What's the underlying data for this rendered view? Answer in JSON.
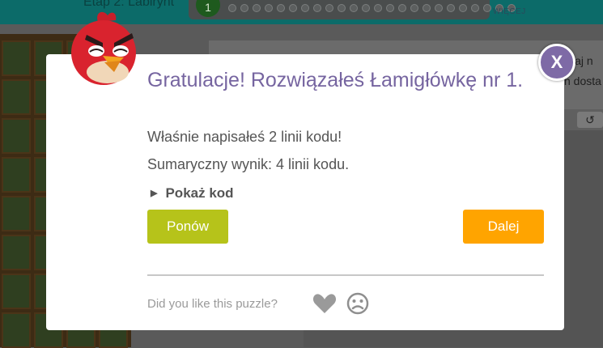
{
  "header": {
    "stage_title": "Etap 2: Labirynt",
    "current_level": "1",
    "more_label": "WIĘCEJ",
    "level_count": 24
  },
  "instructions": {
    "line1": "viaj n",
    "line2": "n dosta"
  },
  "modal": {
    "title": "Gratulacje! Rozwiązałeś Łamigłówkę nr 1.",
    "lines_written": "Właśnie napisałeś 2 linii kodu!",
    "total_score": "Sumaryczny wynik: 4 linii kodu.",
    "show_code": "Pokaż kod",
    "again_button": "Ponów",
    "continue_button": "Dalej",
    "close_button": "X",
    "feedback_question": "Did you like this puzzle?"
  },
  "colors": {
    "title": "#7665a0",
    "again": "#b6c31a",
    "continue": "#ffa400",
    "close": "#7e6aa6",
    "bird": "#d9232e"
  },
  "icons": {
    "bird": "red-bird-avatar-icon",
    "close": "close-icon",
    "expand": "triangle-right-icon",
    "like": "heart-icon",
    "dislike": "sad-face-icon",
    "reset": "reset-icon"
  }
}
